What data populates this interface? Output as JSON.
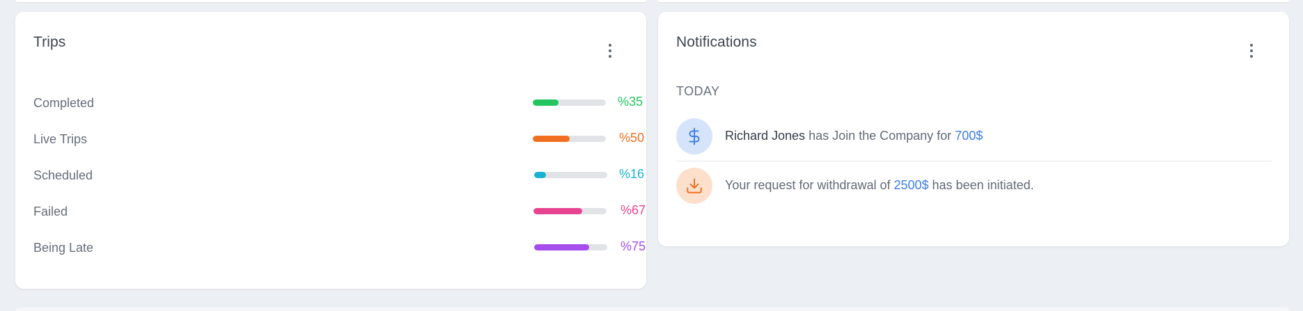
{
  "colors": {
    "completed": "#22c55e",
    "live": "#f07020",
    "scheduled": "#19b3d1",
    "failed": "#e84391",
    "late": "#a64ded",
    "link_blue": "#3b7de8",
    "icon_blue": "#3b7de8",
    "icon_orange": "#f07020"
  },
  "trips": {
    "title": "Trips",
    "menu_icon": "more-vertical-icon",
    "items": [
      {
        "label": "Completed",
        "value": "%35",
        "percent": 35
      },
      {
        "label": "Live Trips",
        "value": "%50",
        "percent": 50
      },
      {
        "label": "Scheduled",
        "value": "%16",
        "percent": 16
      },
      {
        "label": "Failed",
        "value": "%67",
        "percent": 67
      },
      {
        "label": "Being Late",
        "value": "%75",
        "percent": 75
      }
    ]
  },
  "notifications": {
    "title": "Notifications",
    "menu_icon": "more-vertical-icon",
    "section": "TODAY",
    "items": [
      {
        "icon": "dollar-icon",
        "name": "Richard Jones",
        "text_mid": " has Join the Company for ",
        "amount": "700$",
        "text_end": ""
      },
      {
        "icon": "download-icon",
        "text_start": "Your request for withdrawal of ",
        "amount": "2500$",
        "text_end": " has been initiated."
      }
    ]
  }
}
